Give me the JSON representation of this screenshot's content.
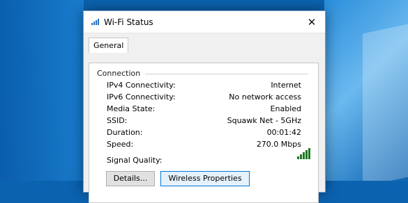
{
  "window": {
    "title": "Wi-Fi Status",
    "title_icon": "wifi-signal-icon",
    "close_icon": "close-icon",
    "close_glyph": "✕"
  },
  "tabs": [
    {
      "label": "General",
      "selected": true
    }
  ],
  "connection": {
    "group_label": "Connection",
    "rows": [
      {
        "label": "IPv4 Connectivity:",
        "value": "Internet"
      },
      {
        "label": "IPv6 Connectivity:",
        "value": "No network access"
      },
      {
        "label": "Media State:",
        "value": "Enabled"
      },
      {
        "label": "SSID:",
        "value": "Squawk Net - 5GHz"
      },
      {
        "label": "Duration:",
        "value": "00:01:42"
      },
      {
        "label": "Speed:",
        "value": "270.0 Mbps"
      }
    ],
    "signal_quality_label": "Signal Quality:",
    "signal_bars": 5,
    "signal_bars_total": 5,
    "signal_icon": "signal-strength-icon"
  },
  "buttons": {
    "details": "Details...",
    "wireless_properties": "Wireless Properties"
  },
  "colors": {
    "accent": "#0078d7",
    "signal": "#1d7a23"
  }
}
